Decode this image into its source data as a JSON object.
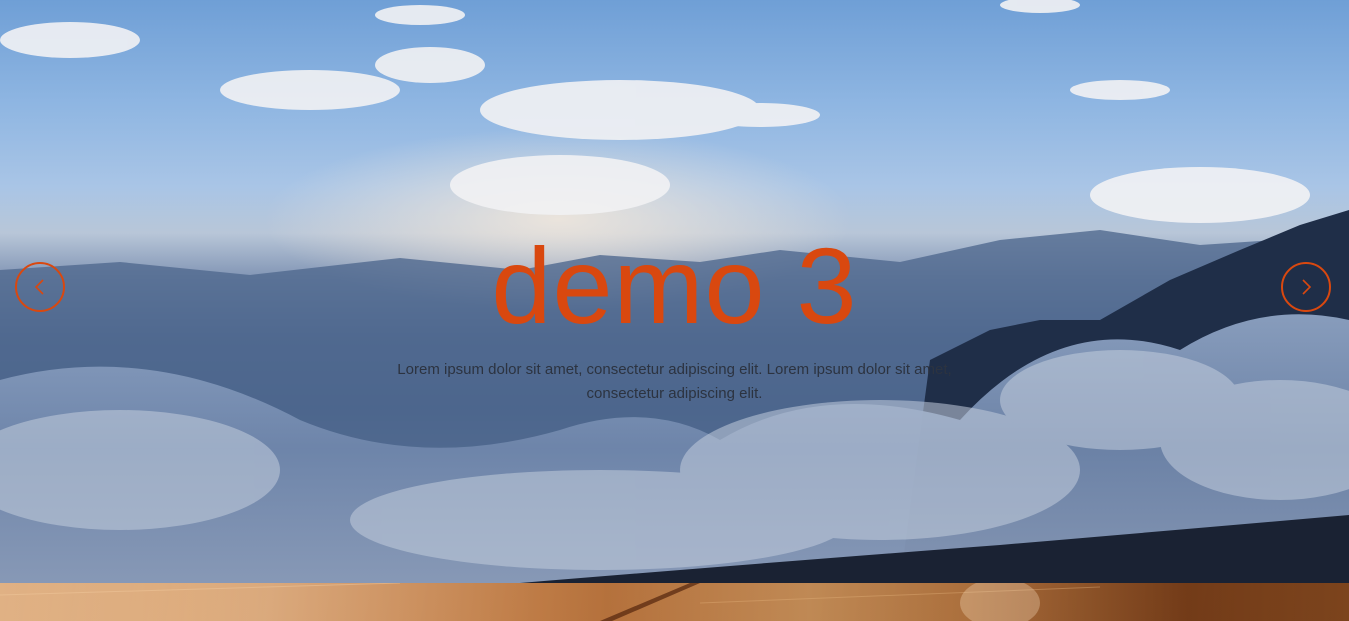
{
  "slide": {
    "title": "demo 3",
    "text": "Lorem ipsum dolor sit amet, consectetur adipiscing elit. Lorem ipsum dolor sit amet, consectetur adipiscing elit."
  },
  "navigation": {
    "prev_icon": "chevron-left-icon",
    "next_icon": "chevron-right-icon"
  },
  "colors": {
    "accent": "#d9480f",
    "text": "#2c3340"
  }
}
